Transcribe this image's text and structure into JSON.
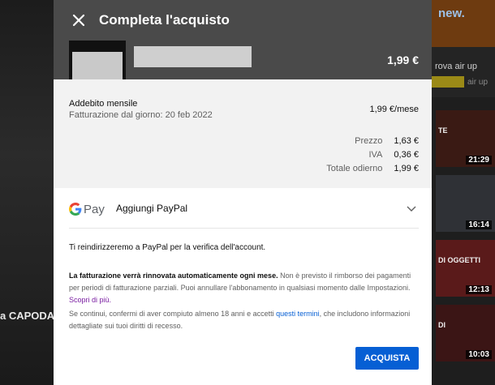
{
  "background": {
    "left_text": "a CAPODA",
    "banner_text": "new.",
    "ad_title": "rova air up",
    "ad_sub": "air up",
    "thumbnails": [
      {
        "time": "21:29",
        "caption": "TE",
        "color": "#3a1a14"
      },
      {
        "time": "16:14",
        "caption": "",
        "color": "#2f3136"
      },
      {
        "time": "12:13",
        "caption": "DI OGGETTI",
        "color": "#5a1a1a"
      },
      {
        "time": "10:03",
        "caption": "DI",
        "color": "#3b1515"
      }
    ]
  },
  "dialog": {
    "title": "Completa l'acquisto",
    "header_price": "1,99 €",
    "billing_label": "Addebito mensile",
    "billing_date": "Fatturazione dal giorno: 20 feb 2022",
    "monthly_price": "1,99 €/mese",
    "breakdown": [
      {
        "label": "Prezzo",
        "value": "1,63 €"
      },
      {
        "label": "IVA",
        "value": "0,36 €"
      },
      {
        "label": "Totale odierno",
        "value": "1,99 €"
      }
    ],
    "payment": {
      "gpay_p": "Pay",
      "label": "Aggiungi PayPal"
    },
    "redirect_text": "Ti reindirizzeremo a PayPal per la verifica dell'account.",
    "renew": {
      "bold": "La fatturazione verrà rinnovata automaticamente ogni mese.",
      "text": " Non è previsto il rimborso dei pagamenti per periodi di fatturazione parziali. Puoi annullare l'abbonamento in qualsiasi momento dalle Impostazioni. ",
      "link": "Scopri di più."
    },
    "terms": {
      "before": "Se continui, confermi di aver compiuto almeno 18 anni e accetti ",
      "link": "questi termini",
      "after": ", che includono informazioni dettagliate sui tuoi diritti di recesso."
    },
    "buy_label": "ACQUISTA"
  },
  "colors": {
    "header_bg": "#4a4a4a",
    "summary_bg": "#f2f2f2",
    "buy_button": "#065fd4",
    "link_purple": "#7b1fa2",
    "link_blue": "#065fd4"
  }
}
